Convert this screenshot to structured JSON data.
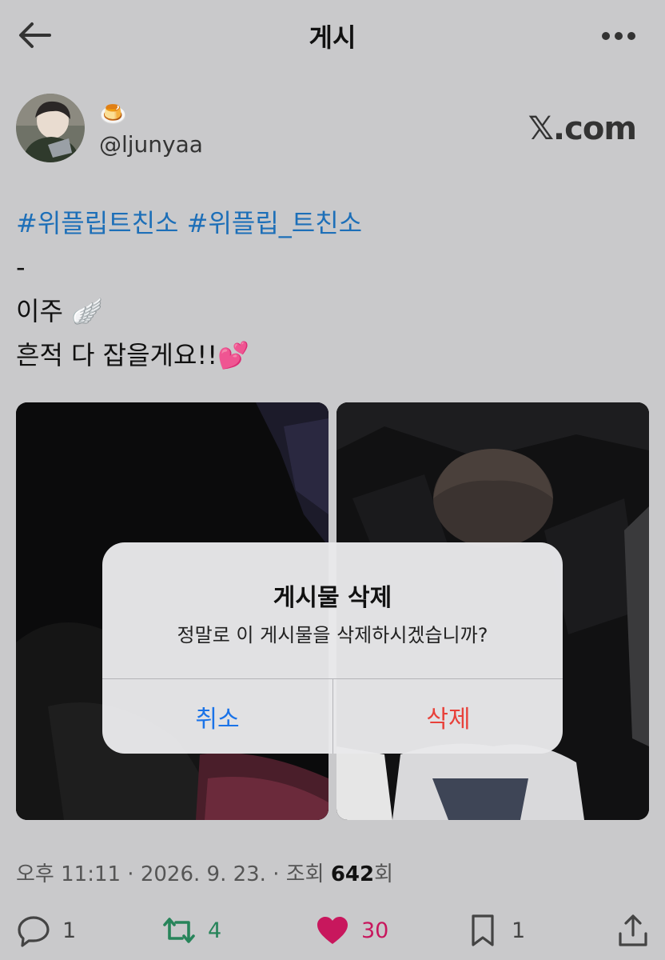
{
  "header": {
    "title": "게시"
  },
  "author": {
    "display_name": "🍮",
    "handle": "@ljunyaa",
    "source": "𝕏.com"
  },
  "tweet": {
    "hashtag_1": "#위플립트친소",
    "hashtag_2": "#위플립_트친소",
    "line_dash": "-",
    "line_2": "이주 🪽",
    "line_3": "흔적 다 잡을게요!!💕"
  },
  "dialog": {
    "title": "게시물 삭제",
    "message": "정말로 이 게시물을 삭제하시겠습니까?",
    "cancel_label": "취소",
    "delete_label": "삭제"
  },
  "meta": {
    "prefix": "오후 11:11 · 2026. 9. 23. · 조회 ",
    "views": "642",
    "suffix": "회"
  },
  "actions": {
    "replies": "1",
    "reposts": "4",
    "likes": "30",
    "bookmarks": "1"
  },
  "colors": {
    "link": "#1d6fb8",
    "repost": "#27845a",
    "like": "#c8175d",
    "cancel": "#1a73e8",
    "delete": "#e8413a"
  }
}
